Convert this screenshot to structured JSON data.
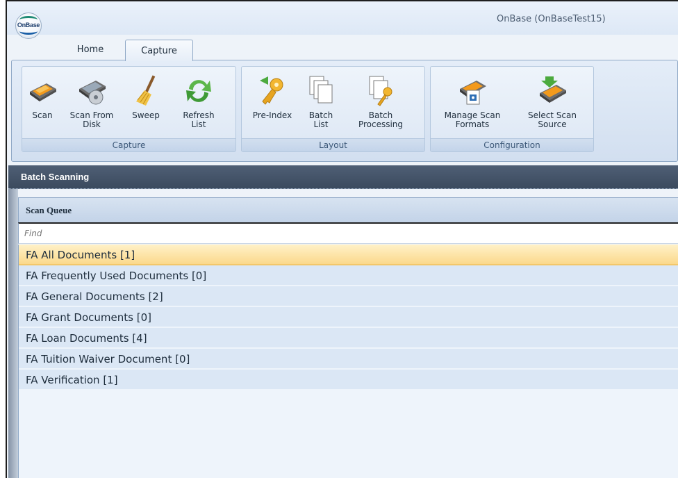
{
  "window": {
    "title": "OnBase (OnBaseTest15)",
    "logo_text": "OnBase"
  },
  "tabs": [
    {
      "label": "Home"
    },
    {
      "label": "Capture"
    }
  ],
  "ribbon": {
    "capture": {
      "label": "Capture",
      "scan": "Scan",
      "scan_from_disk": "Scan From\nDisk",
      "sweep": "Sweep",
      "refresh_list": "Refresh\nList"
    },
    "layout": {
      "label": "Layout",
      "pre_index": "Pre-Index",
      "batch_list": "Batch\nList",
      "batch_processing": "Batch\nProcessing"
    },
    "configuration": {
      "label": "Configuration",
      "manage_scan_formats": "Manage Scan\nFormats",
      "select_scan_source": "Select Scan\nSource"
    }
  },
  "panel": {
    "title": "Batch Scanning"
  },
  "scan_queue": {
    "title": "Scan Queue",
    "find_placeholder": "Find",
    "items": [
      {
        "label": "FA All Documents [1]",
        "selected": true
      },
      {
        "label": "FA Frequently Used Documents [0]"
      },
      {
        "label": "FA General Documents [2]"
      },
      {
        "label": "FA Grant Documents [0]"
      },
      {
        "label": "FA Loan Documents [4]"
      },
      {
        "label": "FA Tuition Waiver Document [0]"
      },
      {
        "label": "FA Verification [1]"
      }
    ]
  },
  "colors": {
    "panel_header": "#3b4a5e",
    "selected_row": "#fbd98c",
    "row": "#dbe7f5"
  }
}
